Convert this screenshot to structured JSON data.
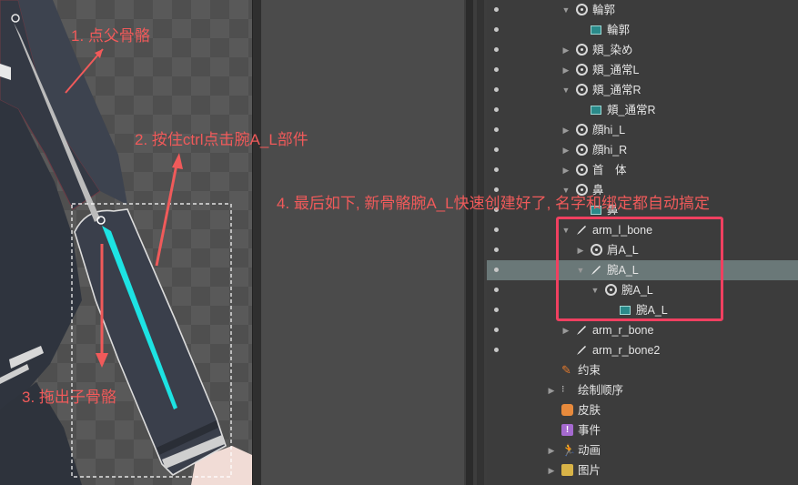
{
  "annotations": {
    "step1": "1. 点父骨骼",
    "step2": "2. 按住ctrl点击腕A_L部件",
    "step3": "3. 拖出子骨骼",
    "step4": "4. 最后如下, 新骨骼腕A_L快速创建好了, 名字和绑定都自动搞定"
  },
  "tree": {
    "rows": [
      {
        "label": "輪郭",
        "icon": "slot",
        "expanded": true
      },
      {
        "label": "輪郭",
        "icon": "attachment"
      },
      {
        "label": "頬_染め",
        "icon": "slot",
        "expanded": false
      },
      {
        "label": "頬_通常L",
        "icon": "slot",
        "expanded": false
      },
      {
        "label": "頬_通常R",
        "icon": "slot",
        "expanded": true
      },
      {
        "label": "頬_通常R",
        "icon": "attachment"
      },
      {
        "label": "顔hi_L",
        "icon": "slot",
        "expanded": false
      },
      {
        "label": "顔hi_R",
        "icon": "slot",
        "expanded": false
      },
      {
        "label": "首　体",
        "icon": "slot",
        "expanded": false
      },
      {
        "label": "鼻",
        "icon": "slot",
        "expanded": true
      },
      {
        "label": "鼻",
        "icon": "attachment"
      },
      {
        "label": "arm_l_bone",
        "icon": "bone",
        "expanded": true
      },
      {
        "label": "肩A_L",
        "icon": "slot",
        "expanded": false
      },
      {
        "label": "腕A_L",
        "icon": "bone",
        "expanded": true,
        "selected": true
      },
      {
        "label": "腕A_L",
        "icon": "slot",
        "expanded": true
      },
      {
        "label": "腕A_L",
        "icon": "attachment"
      },
      {
        "label": "arm_r_bone",
        "icon": "bone",
        "expanded": false
      },
      {
        "label": "arm_r_bone2",
        "icon": "bone"
      },
      {
        "label": "约束",
        "icon": "constraints"
      },
      {
        "label": "绘制顺序",
        "icon": "draw-order",
        "expanded": false
      },
      {
        "label": "皮肤",
        "icon": "skins"
      },
      {
        "label": "事件",
        "icon": "events"
      },
      {
        "label": "动画",
        "icon": "animations",
        "expanded": false
      },
      {
        "label": "图片",
        "icon": "images",
        "expanded": false
      }
    ]
  },
  "colors": {
    "annotation": "#f05a5a",
    "highlight_box": "#f04060",
    "selected_row": "#6a7878",
    "new_bone": "#1de3e3"
  }
}
